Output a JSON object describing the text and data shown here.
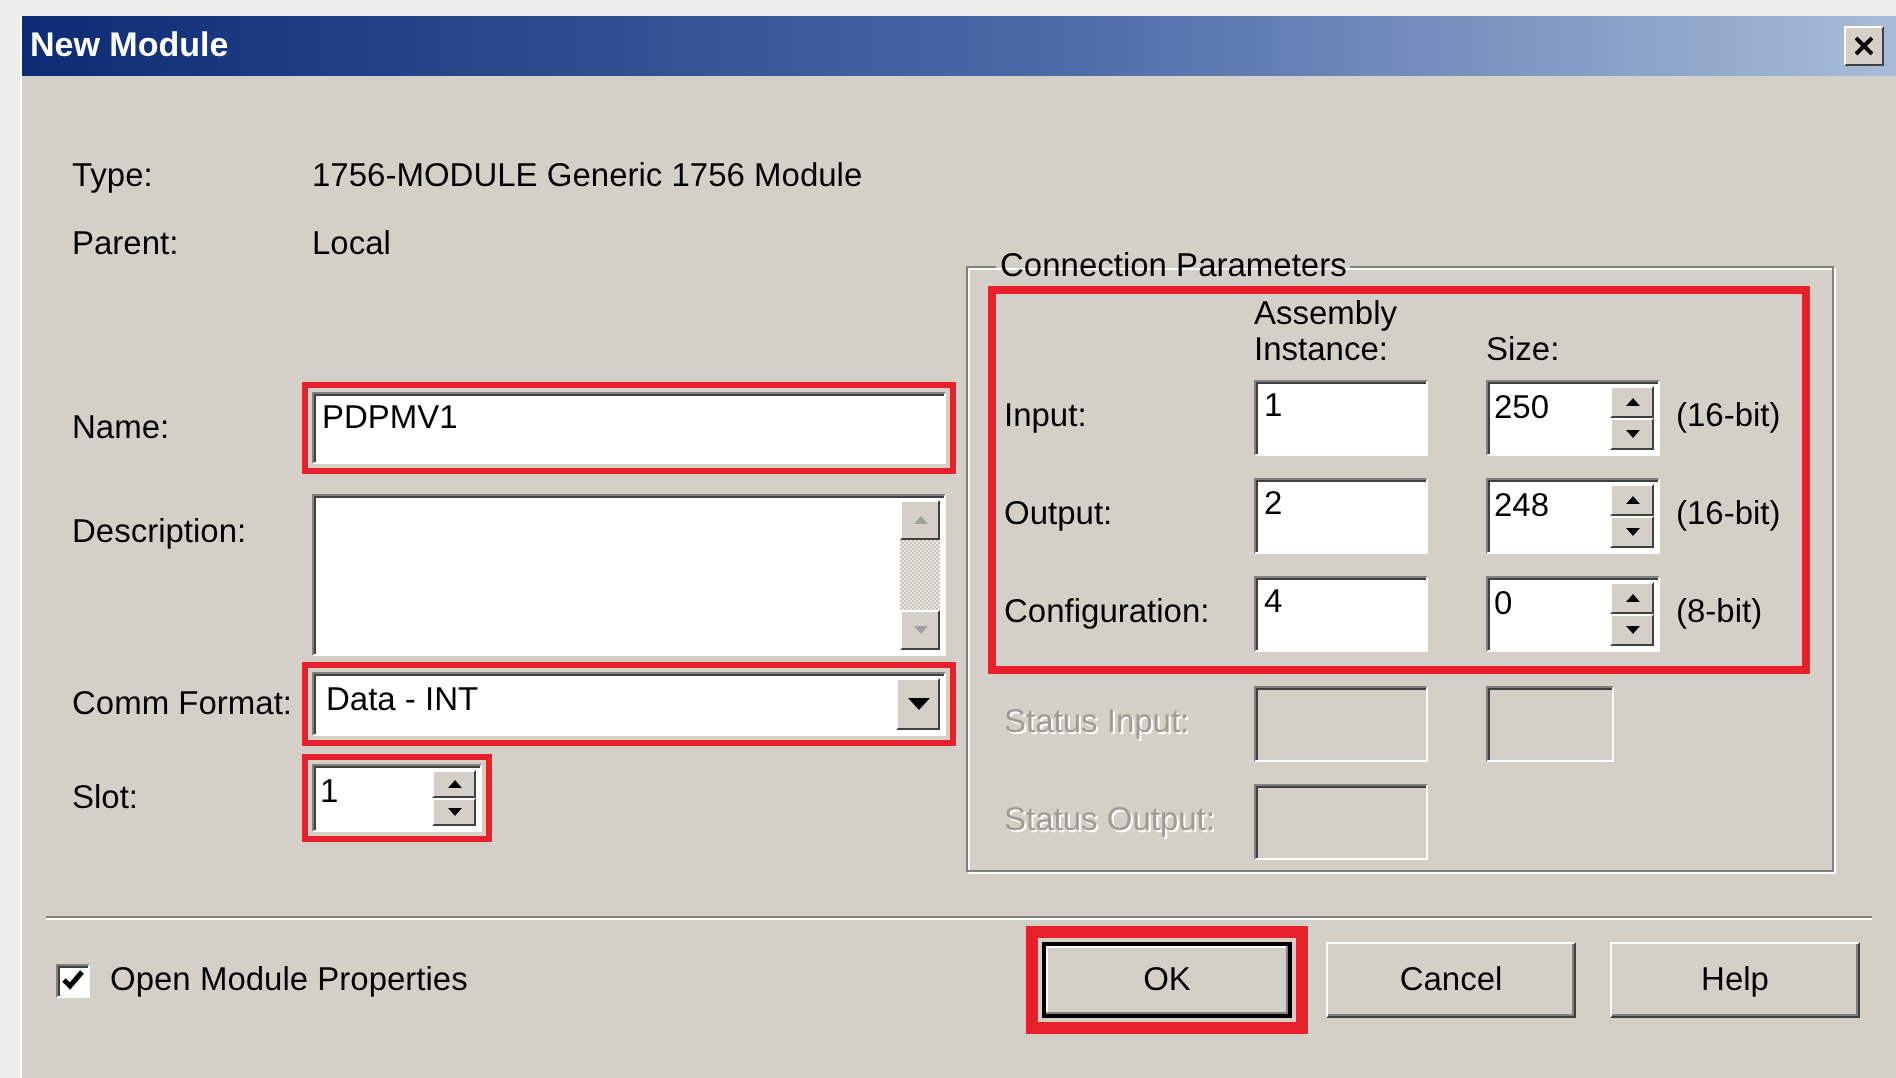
{
  "window": {
    "title": "New Module"
  },
  "info": [
    {
      "label": "Type:",
      "value": "1756-MODULE Generic 1756 Module"
    },
    {
      "label": "Parent:",
      "value": "Local"
    }
  ],
  "name": {
    "label": "Name:",
    "value": "PDPMV1",
    "highlighted": true
  },
  "description": {
    "label": "Description:"
  },
  "comm_format": {
    "label": "Comm Format:",
    "value": "Data - INT",
    "highlighted": true
  },
  "slot": {
    "label": "Slot:",
    "value": "1",
    "highlighted": true
  },
  "connection_parameters": {
    "title": "Connection Parameters",
    "highlighted": true,
    "columns": [
      "Assembly Instance:",
      "Size:"
    ],
    "rows": [
      {
        "kind": "spin",
        "label": "Input:",
        "instance": "1",
        "size": "250",
        "unit": "(16-bit)",
        "disabled": false
      },
      {
        "kind": "spin",
        "label": "Output:",
        "instance": "2",
        "size": "248",
        "unit": "(16-bit)",
        "disabled": false
      },
      {
        "kind": "spin",
        "label": "Configuration:",
        "instance": "4",
        "size": "0",
        "unit": "(8-bit)",
        "disabled": false
      },
      {
        "kind": "pair",
        "label": "Status Input:",
        "disabled": true
      },
      {
        "kind": "single",
        "label": "Status Output:",
        "disabled": true
      }
    ]
  },
  "open_module_properties": {
    "label": "Open Module Properties",
    "checked": true
  },
  "buttons": [
    {
      "label": "OK",
      "default": true,
      "highlighted": true
    },
    {
      "label": "Cancel",
      "default": false,
      "highlighted": false
    },
    {
      "label": "Help",
      "default": false,
      "highlighted": false
    }
  ]
}
